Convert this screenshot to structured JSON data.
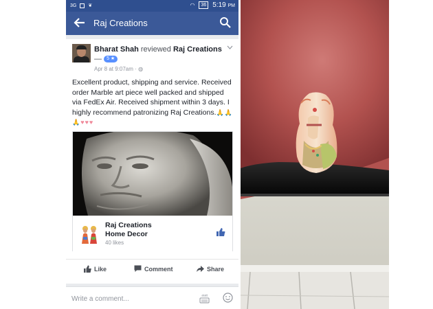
{
  "status_bar": {
    "network": "3G",
    "battery": "36",
    "time": "5:19",
    "time_suffix": "PM"
  },
  "app_bar": {
    "title": "Raj Creations"
  },
  "post": {
    "author": "Bharat Shah",
    "action": "reviewed",
    "page": "Raj Creations",
    "separator": "—",
    "rating": "5 ★",
    "date": "Apr 8 at 9:07am",
    "privacy_dot": "·",
    "text": "Excellent product, shipping and service. Received order Marble art piece well packed and shipped via FedEx Air. Received shipment within 3 days. I highly recommend patronizing Raj Creations.",
    "emoji_hands": "🙏🙏🙏",
    "emoji_hearts": "♥♥♥"
  },
  "link_card": {
    "name_line1": "Raj Creations",
    "name_line2": "Home Decor",
    "likes": "40 likes"
  },
  "actions": {
    "like": "Like",
    "comment": "Comment",
    "share": "Share"
  },
  "comment_bar": {
    "placeholder": "Write a comment...",
    "keyboard_label": "अआ"
  },
  "colors": {
    "facebook_blue": "#3b5998",
    "status_bar": "#2f4f8f",
    "rating_badge": "#5890ff"
  }
}
